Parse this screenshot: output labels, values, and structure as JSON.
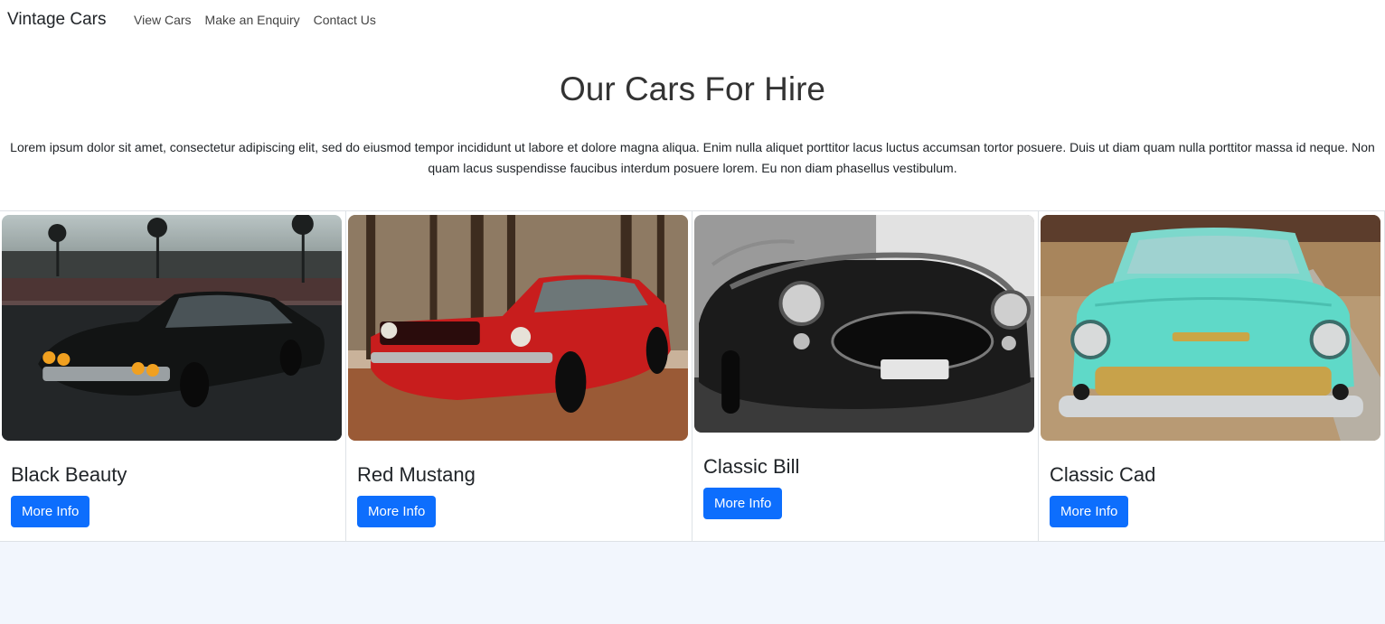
{
  "nav": {
    "brand": "Vintage Cars",
    "links": [
      "View Cars",
      "Make an Enquiry",
      "Contact Us"
    ]
  },
  "hero": {
    "title": "Our Cars For Hire",
    "text": "Lorem ipsum dolor sit amet, consectetur adipiscing elit, sed do eiusmod tempor incididunt ut labore et dolore magna aliqua. Enim nulla aliquet porttitor lacus luctus accumsan tortor posuere. Duis ut diam quam nulla porttitor massa id neque. Non quam lacus suspendisse faucibus interdum posuere lorem. Eu non diam phasellus vestibulum."
  },
  "cars": [
    {
      "title": "Black Beauty",
      "button": "More Info",
      "image": "black-classic-car-photo"
    },
    {
      "title": "Red Mustang",
      "button": "More Info",
      "image": "red-mustang-photo"
    },
    {
      "title": "Classic Bill",
      "button": "More Info",
      "image": "black-and-white-roadster-photo"
    },
    {
      "title": "Classic Cad",
      "button": "More Info",
      "image": "turquoise-chevrolet-photo"
    }
  ],
  "colors": {
    "button": "#0d6efd",
    "page_bottom": "#f2f6fd",
    "border": "#dee2e6"
  }
}
